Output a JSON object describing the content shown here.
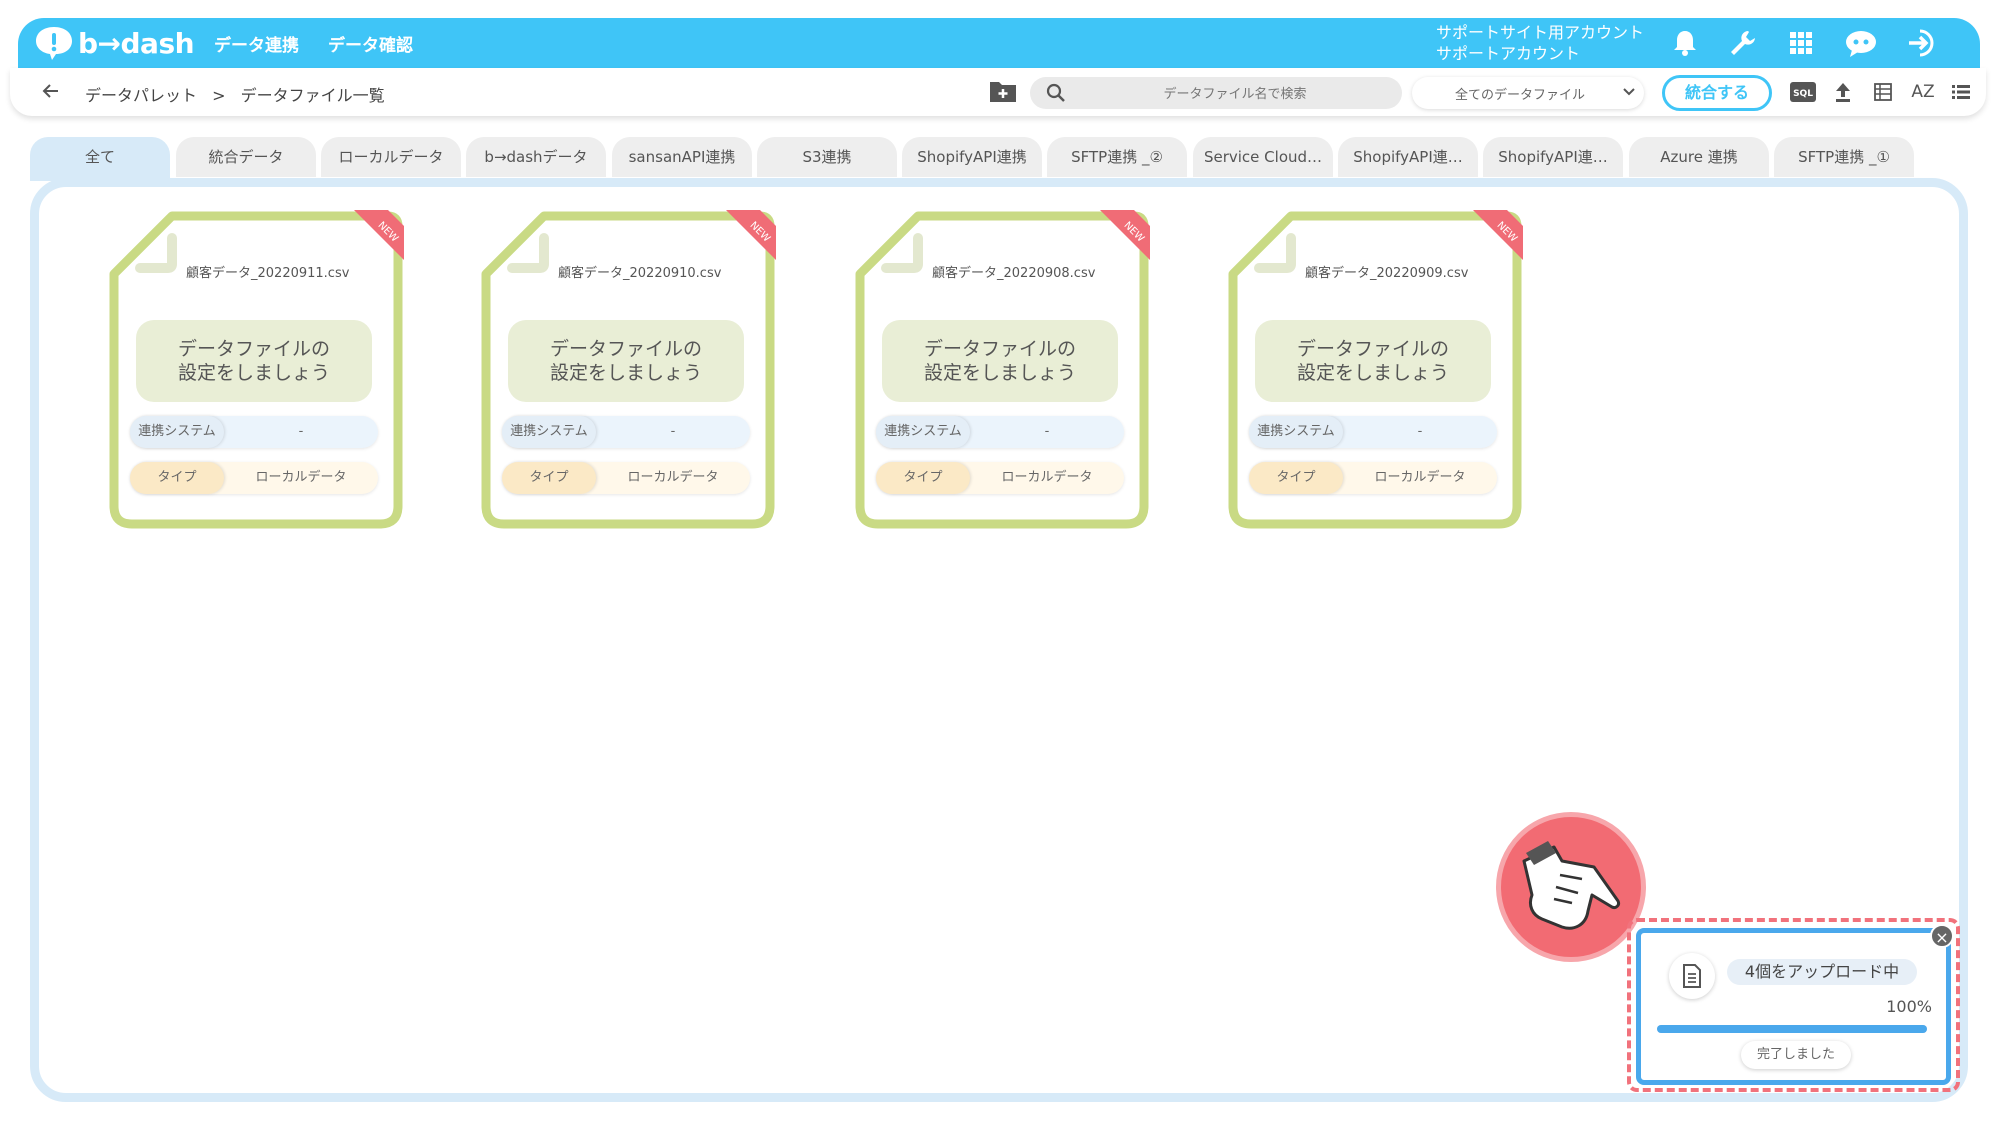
{
  "header": {
    "logo": "b→dash",
    "nav": [
      "データ連携",
      "データ確認"
    ],
    "account_line1": "サポートサイト用アカウント",
    "account_line2": "サポートアカウント",
    "icons": [
      "bell-icon",
      "wrench-icon",
      "apps-grid-icon",
      "chat-robot-icon",
      "logout-icon"
    ],
    "accent_color": "#3fc5f7"
  },
  "toolbar": {
    "breadcrumb": [
      "データパレット",
      "データファイル一覧"
    ],
    "breadcrumb_sep": ">",
    "search_placeholder": "データファイル名で検索",
    "filter_selected": "全てのデータファイル",
    "merge_label": "統合する",
    "sql_label": "SQL",
    "sort_label": "AZ"
  },
  "tabs": [
    "全て",
    "統合データ",
    "ローカルデータ",
    "b→dashデータ",
    "sansanAPI連携",
    "S3連携",
    "ShopifyAPI連携",
    "SFTP連携 _②",
    "Service Cloud…",
    "ShopifyAPI連…",
    "ShopifyAPI連…",
    "Azure 連携",
    "SFTP連携 _①"
  ],
  "active_tab": "全て",
  "cards": [
    {
      "filename": "顧客データ_20220911.csv",
      "badge": "NEW",
      "setup_line1": "データファイルの",
      "setup_line2": "設定をしましょう",
      "system_label": "連携システム",
      "system_value": "-",
      "type_label": "タイプ",
      "type_value": "ローカルデータ"
    },
    {
      "filename": "顧客データ_20220910.csv",
      "badge": "NEW",
      "setup_line1": "データファイルの",
      "setup_line2": "設定をしましょう",
      "system_label": "連携システム",
      "system_value": "-",
      "type_label": "タイプ",
      "type_value": "ローカルデータ"
    },
    {
      "filename": "顧客データ_20220908.csv",
      "badge": "NEW",
      "setup_line1": "データファイルの",
      "setup_line2": "設定をしましょう",
      "system_label": "連携システム",
      "system_value": "-",
      "type_label": "タイプ",
      "type_value": "ローカルデータ"
    },
    {
      "filename": "顧客データ_20220909.csv",
      "badge": "NEW",
      "setup_line1": "データファイルの",
      "setup_line2": "設定をしましょう",
      "system_label": "連携システム",
      "system_value": "-",
      "type_label": "タイプ",
      "type_value": "ローカルデータ"
    }
  ],
  "upload": {
    "status": "4個をアップロード中",
    "percent_text": "100%",
    "progress": 1.0,
    "done_label": "完了しました",
    "close_symbol": "×"
  }
}
